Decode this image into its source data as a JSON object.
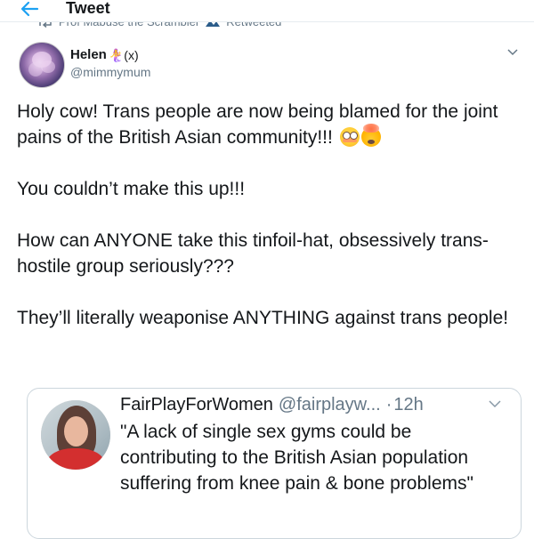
{
  "header": {
    "title": "Tweet"
  },
  "retweet_context": {
    "text": "Prof Mabuse the Scrambler",
    "action": "Retweeted"
  },
  "author": {
    "display_name": "Helen",
    "name_emoji": "🧜‍♀️(x)",
    "handle": "@mimmymum"
  },
  "tweet": {
    "paragraphs": [
      "Holy cow! Trans people are now being blamed for the joint pains of the British Asian community!!!",
      "You couldn’t make this up!!!",
      "How can ANYONE take this tinfoil-hat, obsessively trans-hostile group seriously???",
      "They’ll literally weaponise ANYTHING against trans people!"
    ],
    "emojis": [
      "flushed-face",
      "exploding-head"
    ]
  },
  "quote": {
    "name": "FairPlayForWomen",
    "handle": "@fairplayw...",
    "separator": "·",
    "time": "12h",
    "text": "\"A lack of single sex gyms could be contributing to the British Asian population suffering from knee pain & bone problems\""
  },
  "colors": {
    "accent": "#1da1f2",
    "text": "#14171a",
    "secondary": "#657786",
    "border": "#ccd6dd"
  }
}
